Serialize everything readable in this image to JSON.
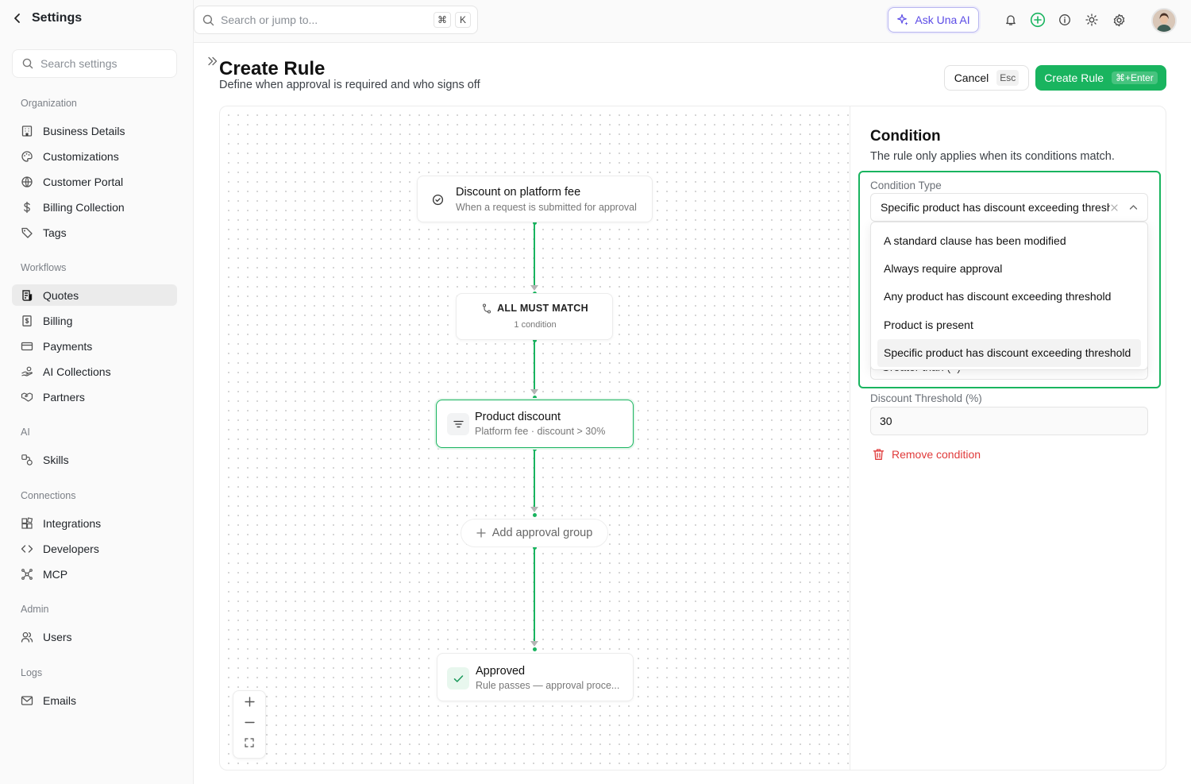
{
  "sidebar": {
    "title": "Settings",
    "search_placeholder": "Search settings",
    "sections": {
      "organization": "Organization",
      "workflows": "Workflows",
      "ai": "AI",
      "connections": "Connections",
      "admin": "Admin",
      "logs": "Logs"
    },
    "items": {
      "business_details": "Business Details",
      "customizations": "Customizations",
      "customer_portal": "Customer Portal",
      "billing_collection": "Billing Collection",
      "tags": "Tags",
      "quotes": "Quotes",
      "billing": "Billing",
      "payments": "Payments",
      "ai_collections": "AI Collections",
      "partners": "Partners",
      "skills": "Skills",
      "integrations": "Integrations",
      "developers": "Developers",
      "mcp": "MCP",
      "users": "Users",
      "emails": "Emails"
    },
    "active_item": "Quotes"
  },
  "topbar": {
    "search_placeholder": "Search or jump to...",
    "shortcut_keys": [
      "⌘",
      "K"
    ],
    "ask_label": "Ask Una AI"
  },
  "page": {
    "title": "Create Rule",
    "subtitle": "Define when approval is required and who signs off",
    "cancel_label": "Cancel",
    "cancel_key": "Esc",
    "create_label": "Create Rule",
    "create_key": "⌘+Enter"
  },
  "flow": {
    "trigger": {
      "title": "Discount on platform fee",
      "subtitle": "When a request is submitted for approval"
    },
    "match": {
      "title": "ALL MUST MATCH",
      "subtitle": "1 condition"
    },
    "condition": {
      "title": "Product discount",
      "subtitle": "Platform fee · discount > 30%"
    },
    "add_group": "Add approval group",
    "approved": {
      "title": "Approved",
      "subtitle": "Rule passes — approval proce..."
    }
  },
  "panel": {
    "title": "Condition",
    "subtitle": "The rule only applies when its conditions match.",
    "condition_type_label": "Condition Type",
    "condition_type_value": "Specific product has discount exceeding threshold",
    "options": [
      "A standard clause has been modified",
      "Always require approval",
      "Any product has discount exceeding threshold",
      "Product is present",
      "Specific product has discount exceeding threshold"
    ],
    "hidden_operator_value": "Greater than (>)",
    "threshold_label": "Discount Threshold (%)",
    "threshold_value": "30",
    "remove_label": "Remove condition"
  },
  "colors": {
    "accent_green": "#19b45f",
    "ai_purple": "#5b4be6",
    "danger_red": "#e03a3a"
  }
}
